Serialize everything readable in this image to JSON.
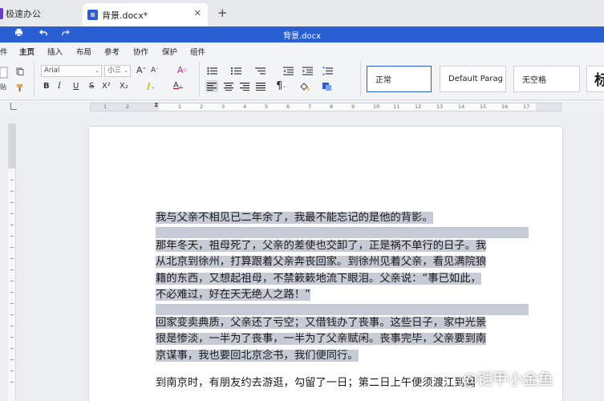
{
  "tabs": {
    "home_label": "极速办公",
    "doc_label": "背景.docx*",
    "close_glyph": "✕",
    "add_glyph": "+"
  },
  "titlebar": {
    "title": "背景.docx",
    "accent": "#2a5fd3"
  },
  "menu": {
    "items": [
      "件",
      "主页",
      "插入",
      "布局",
      "参考",
      "协作",
      "保护",
      "组件"
    ],
    "active_index": 1
  },
  "ribbon": {
    "font_name": "Arial",
    "font_size": "小三",
    "format_buttons": [
      "B",
      "I",
      "U",
      "S",
      "X²",
      "X₂"
    ],
    "grow_font": "A",
    "shrink_font": "A",
    "clear_format": "A",
    "font_color_label": "A",
    "highlight_label": "ℓ",
    "pilcrow": "¶",
    "left_labels": [
      "贴"
    ],
    "styles": [
      "正常",
      "Default Parag",
      "无空格",
      "标"
    ]
  },
  "ruler": {
    "numbers": [
      "1",
      "2",
      "1",
      "1",
      "2",
      "3",
      "4",
      "5",
      "6",
      "7",
      "8",
      "9",
      "10",
      "11",
      "12",
      "13",
      "14",
      "15",
      "16",
      "17"
    ]
  },
  "document": {
    "paragraphs": [
      {
        "lines": [
          "我与父亲不相见已二年余了，我最不能忘记的是他的背影。"
        ],
        "highlight": true
      },
      {
        "lines": [
          "那年冬天，祖母死了，父亲的差使也交卸了，正是祸不单行的日子。我",
          "从北京到徐州，打算跟着父亲奔丧回家。到徐州见着父亲，看见满院狼",
          "籍的东西，又想起祖母，不禁簌簌地流下眼泪。父亲说：“事已如此，",
          "不必难过，好在天无绝人之路！”"
        ],
        "highlight": true
      },
      {
        "lines": [
          "回家变卖典质，父亲还了亏空；又借钱办了丧事。这些日子，家中光景",
          "很是惨淡，一半为了丧事，一半为了父亲赋闲。丧事完毕，父亲要到南",
          "京谋事，我也要回北京念书，我们便同行。"
        ],
        "highlight": true
      },
      {
        "lines": [
          "到南京时，有朋友约去游逛，勾留了一日；第二日上午便须渡江到浦"
        ],
        "highlight": false
      }
    ],
    "highlight_color": "#c6cbd6"
  },
  "watermark": {
    "text": "@铠甲小金鱼"
  }
}
